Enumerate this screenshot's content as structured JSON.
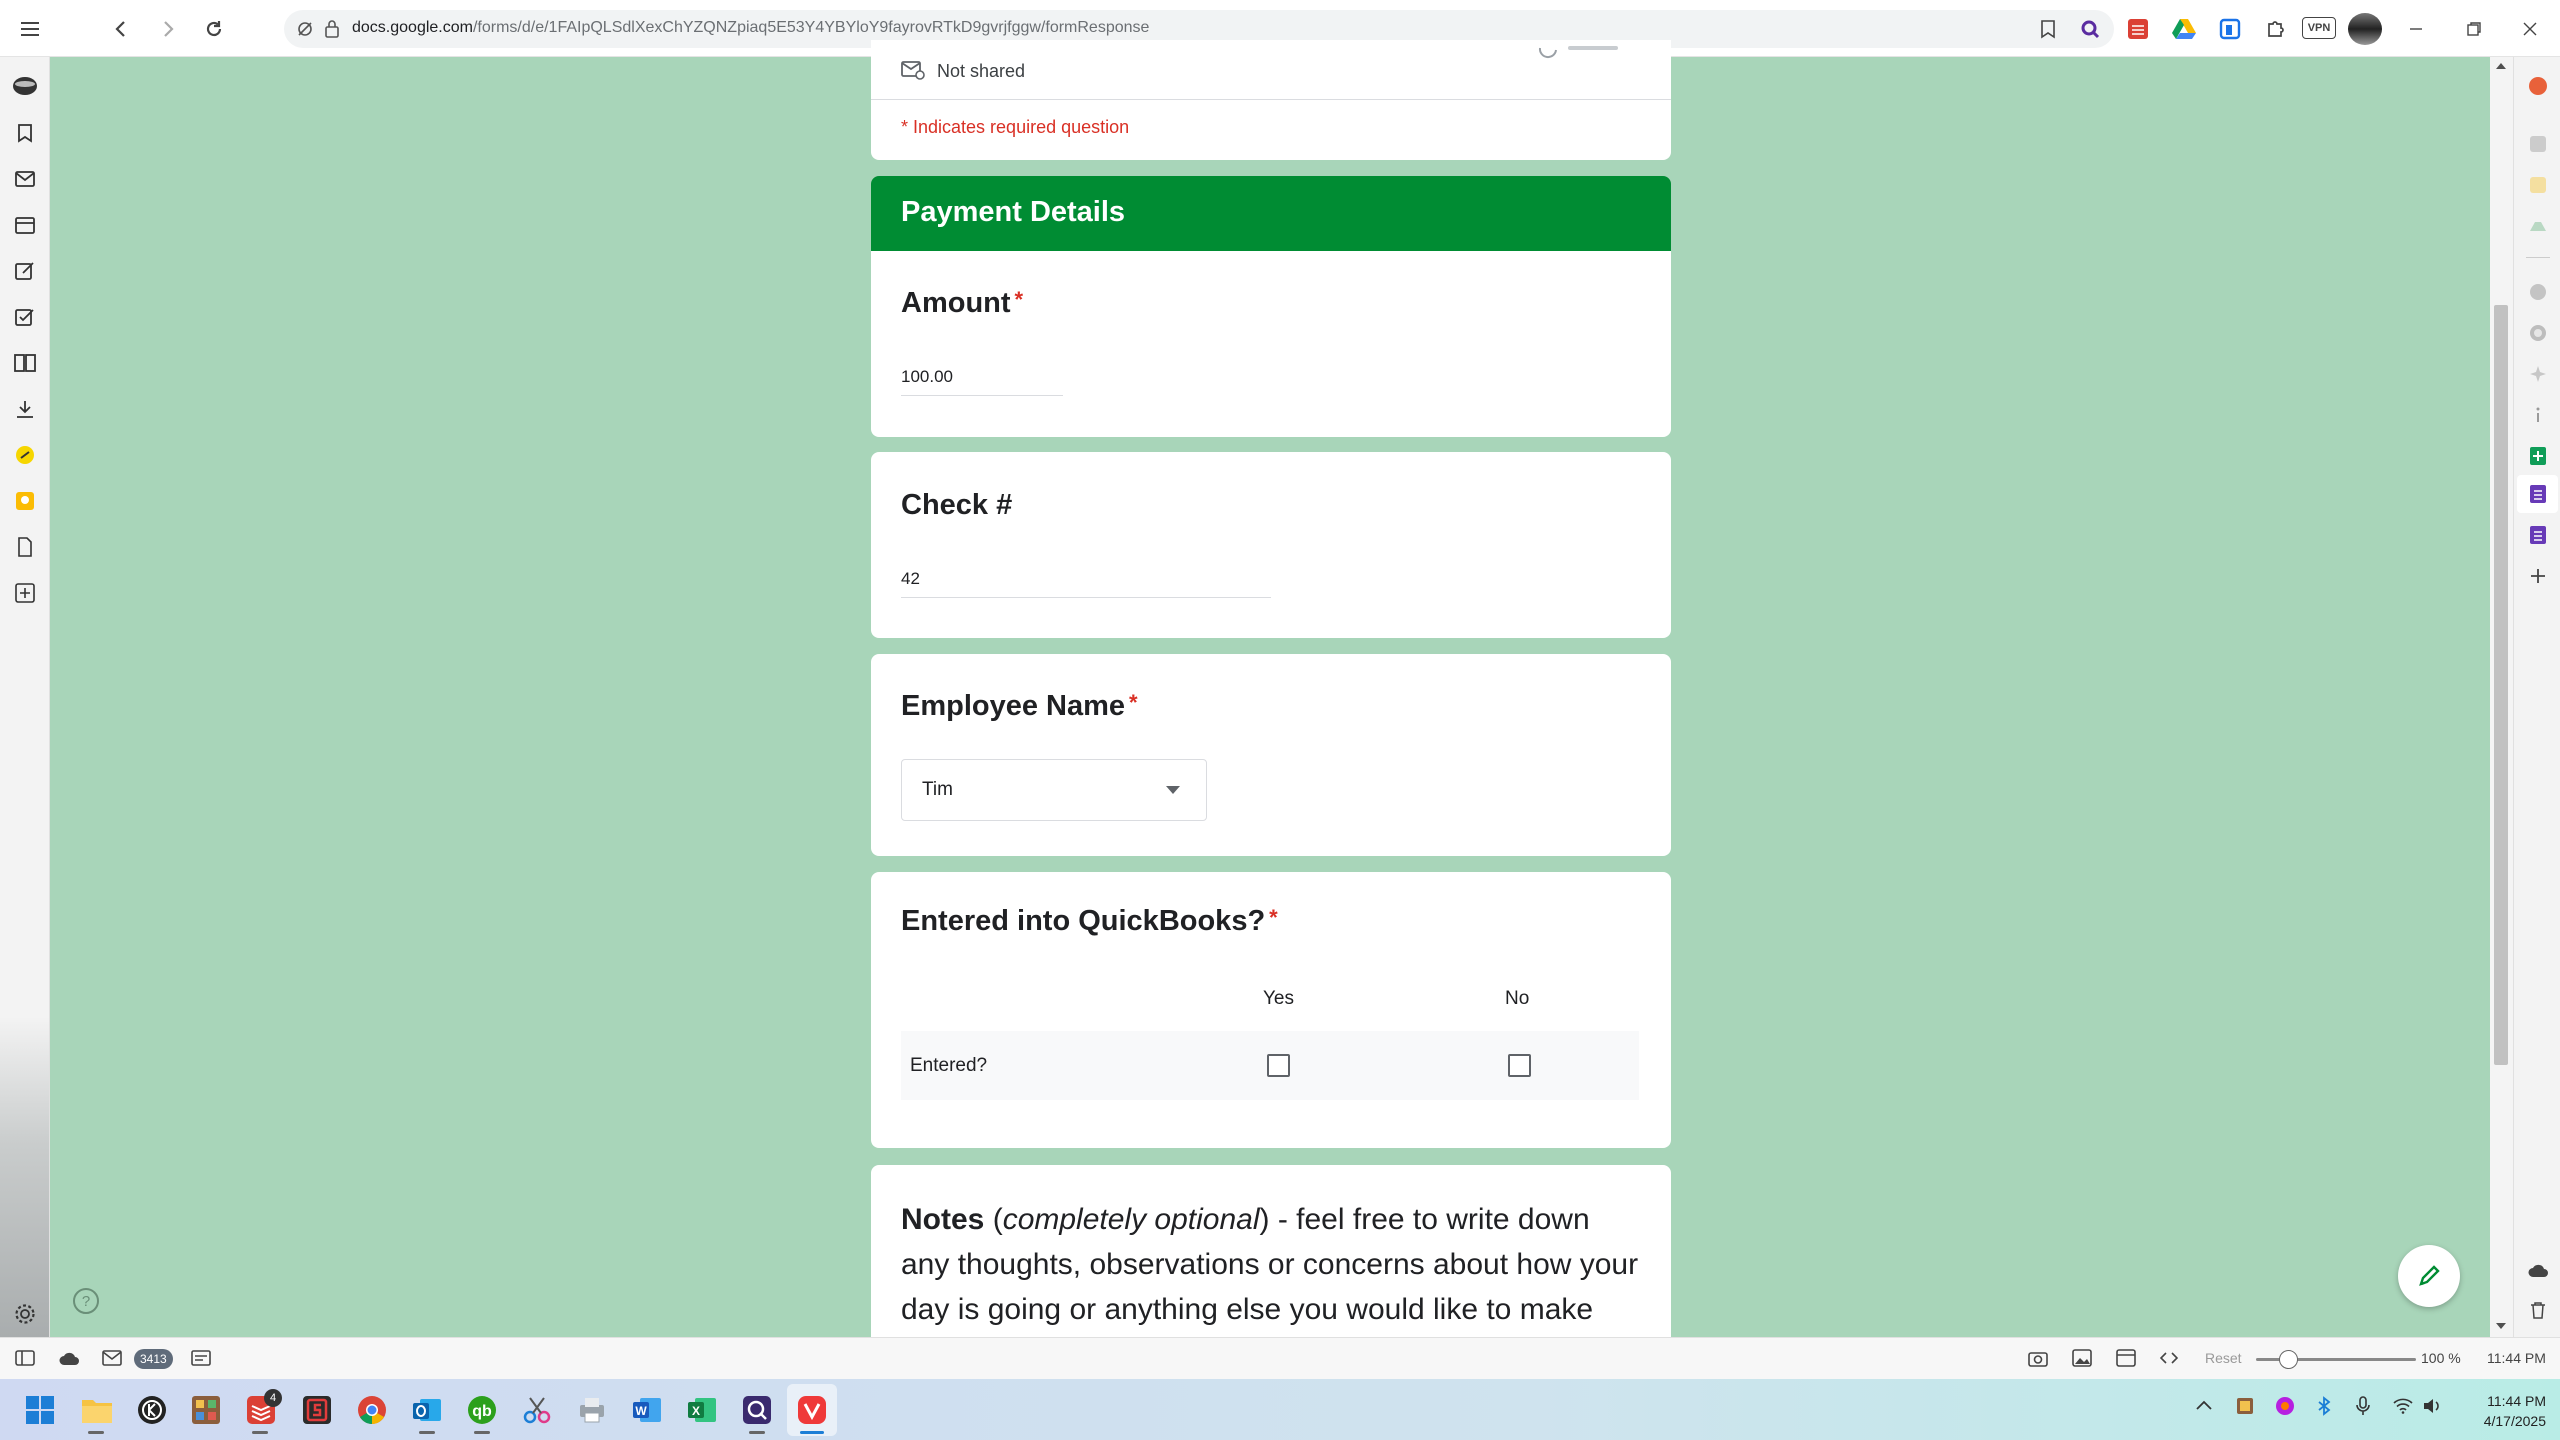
{
  "browser": {
    "url_host": "docs.google.com",
    "url_path": "/forms/d/e/1FAIpQLSdlXexChYZQNZpiaq5E53Y4YBYloY9fayrovRTkD9gvrjfggw/formResponse",
    "extension_vpn_label": "VPN"
  },
  "form": {
    "not_shared_label": "Not shared",
    "required_note": "* Indicates required question",
    "section_title": "Payment Details",
    "amount": {
      "label": "Amount",
      "required_mark": "*",
      "value": "100.00"
    },
    "check": {
      "label": "Check #",
      "value": "42"
    },
    "employee": {
      "label": "Employee Name",
      "required_mark": "*",
      "selected": "Tim"
    },
    "quickbooks": {
      "label": "Entered into QuickBooks?",
      "required_mark": "*",
      "col_yes": "Yes",
      "col_no": "No",
      "row_label": "Entered?"
    },
    "notes": {
      "bold": "Notes",
      "open_paren": " (",
      "italic": "completely optional",
      "rest_line1": ") - feel free to write down",
      "line2": "any thoughts, observations or concerns about how your",
      "line3": "day is going or anything else you would like to make"
    }
  },
  "statusbar": {
    "mail_count": "3413",
    "reset_label": "Reset",
    "zoom": "100 %",
    "time": "11:44 PM",
    "zoom_level": 0.2
  },
  "taskbar": {
    "time": "11:44 PM",
    "date": "4/17/2025",
    "todo_badge": "4"
  },
  "colors": {
    "background": "#a8d5b9",
    "header": "#008c33",
    "required": "#d93025"
  }
}
